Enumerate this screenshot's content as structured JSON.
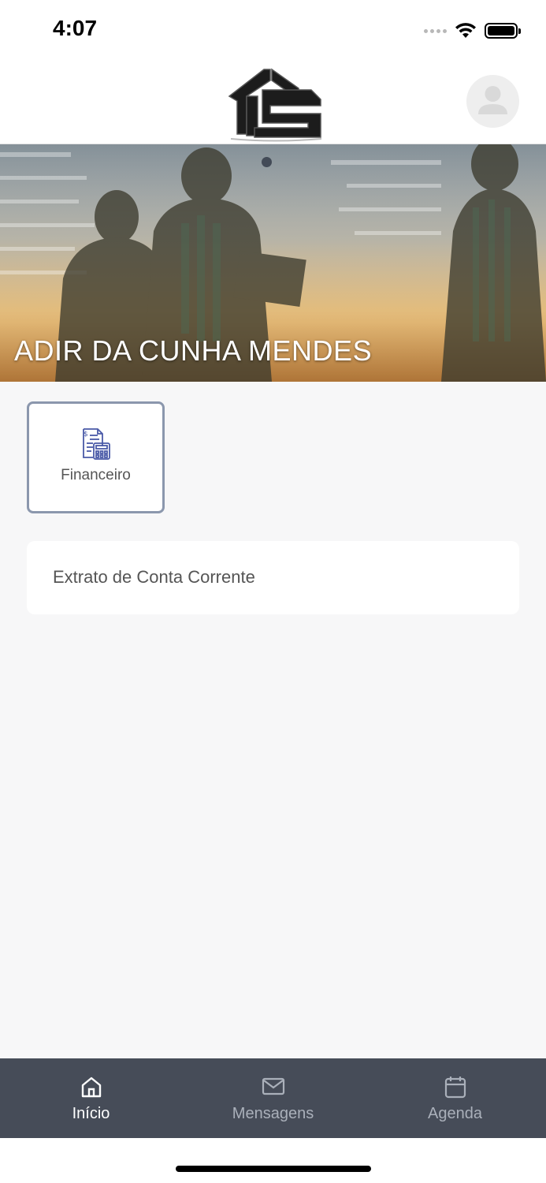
{
  "status_bar": {
    "time": "4:07"
  },
  "header": {
    "logo_icon": "company-logo-ts",
    "avatar_icon": "user-avatar-icon"
  },
  "banner": {
    "title": "ADIR DA CUNHA MENDES",
    "carousel_dots": 1
  },
  "modules": [
    {
      "label": "Financeiro",
      "icon": "financial-document-calculator-icon"
    }
  ],
  "menu": {
    "items": [
      {
        "label": "Extrato de Conta Corrente"
      }
    ]
  },
  "tab_bar": {
    "items": [
      {
        "label": "Início",
        "icon": "home-icon",
        "active": true
      },
      {
        "label": "Mensagens",
        "icon": "mail-icon",
        "active": false
      },
      {
        "label": "Agenda",
        "icon": "calendar-icon",
        "active": false
      }
    ]
  },
  "colors": {
    "tab_bar_bg": "#464c58",
    "accent_icon": "#4a5aa8",
    "card_border": "#8b97ad",
    "background": "#f7f7f8"
  }
}
